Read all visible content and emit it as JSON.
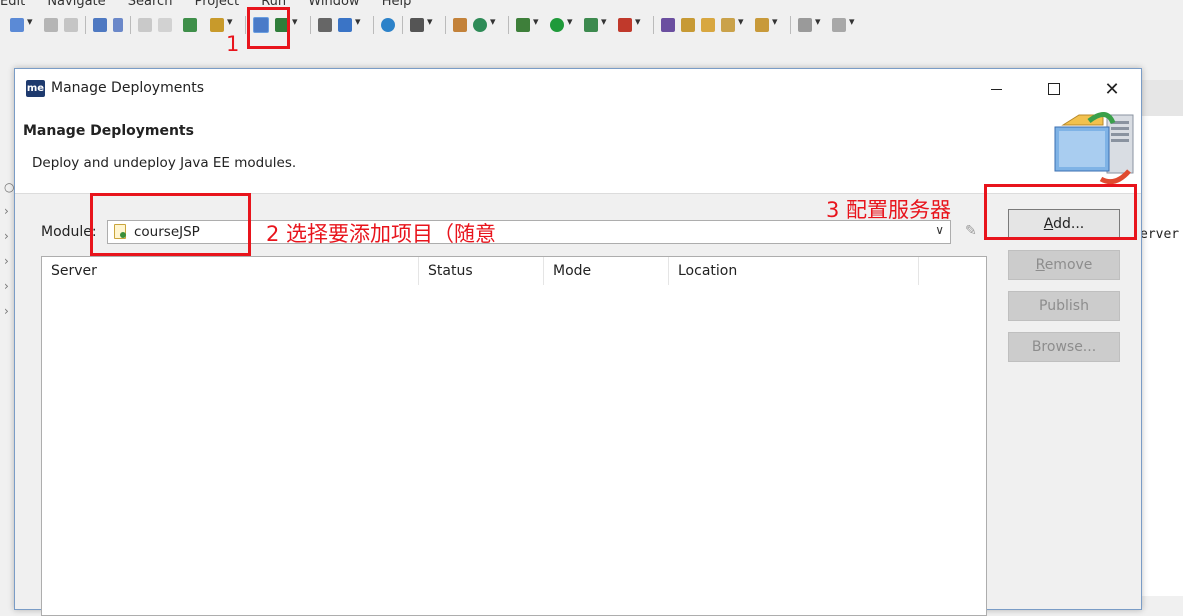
{
  "menu": [
    "Edit",
    "Navigate",
    "Search",
    "Project",
    "Run",
    "Window",
    "Help"
  ],
  "dialog": {
    "window_title": "Manage Deployments",
    "app_icon": "me",
    "header_title": "Manage Deployments",
    "header_description": "Deploy and undeploy Java EE modules.",
    "module_label": "Module:",
    "module_value": "courseJSP",
    "table_columns": [
      "Server",
      "Status",
      "Mode",
      "Location"
    ],
    "buttons": {
      "add": "Add...",
      "remove": "Remove",
      "publish": "Publish",
      "browse": "Browse..."
    }
  },
  "background": {
    "right_text": "erver"
  },
  "annotations": {
    "step1": "1",
    "step2": "2 选择要添加项目（随意",
    "step3": "3 配置服务器"
  },
  "colors": {
    "annotation": "#e8141c",
    "dialog_border": "#7a9cc6"
  }
}
